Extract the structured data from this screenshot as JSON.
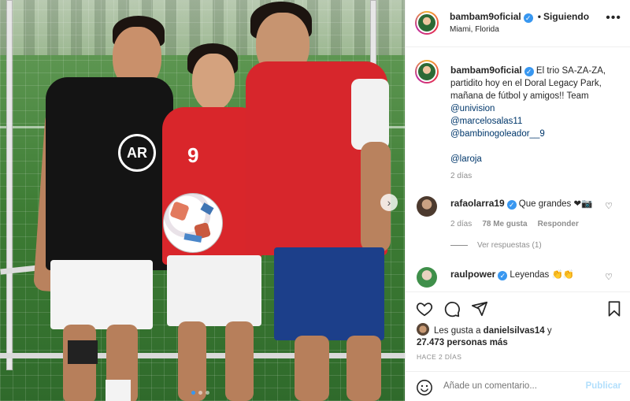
{
  "post": {
    "username": "bambam9oficial",
    "follow_status": "Siguiendo",
    "separator": "•",
    "location": "Miami, Florida",
    "verified_icon": "verified-badge-icon",
    "more_options": "•••"
  },
  "photo": {
    "shirt_number": "9",
    "badge_text": "AR",
    "next_arrow": "›",
    "carousel_dots": 3,
    "active_dot": 0
  },
  "caption": {
    "username": "bambam9oficial",
    "text": "El trio SA-ZA-ZA, partidito hoy en el Doral Legacy Park, mañana de fútbol y amigos!! Team",
    "mentions": [
      "@univision",
      "@marcelosalas11",
      "@bambinogoleador__9",
      "@laroja"
    ],
    "time": "2 días"
  },
  "comments": [
    {
      "username": "rafaolarra19",
      "text": "Que grandes ❤📷",
      "time": "2 días",
      "likes": "78 Me gusta",
      "reply_label": "Responder",
      "replies_label": "Ver respuestas (1)"
    },
    {
      "username": "raulpower",
      "text": "Leyendas 👏👏"
    }
  ],
  "likes": {
    "prefix": "Les gusta a",
    "user": "danielsilvas14",
    "conj": "y",
    "count_text": "27.473 personas más"
  },
  "timestamp": "HACE 2 DÍAS",
  "add_comment": {
    "placeholder": "Añade un comentario...",
    "post_label": "Publicar"
  },
  "colors": {
    "accent_blue": "#3897f0",
    "mention": "#00376b",
    "muted": "#8e8e8e",
    "post_disabled": "#b2dffc"
  }
}
